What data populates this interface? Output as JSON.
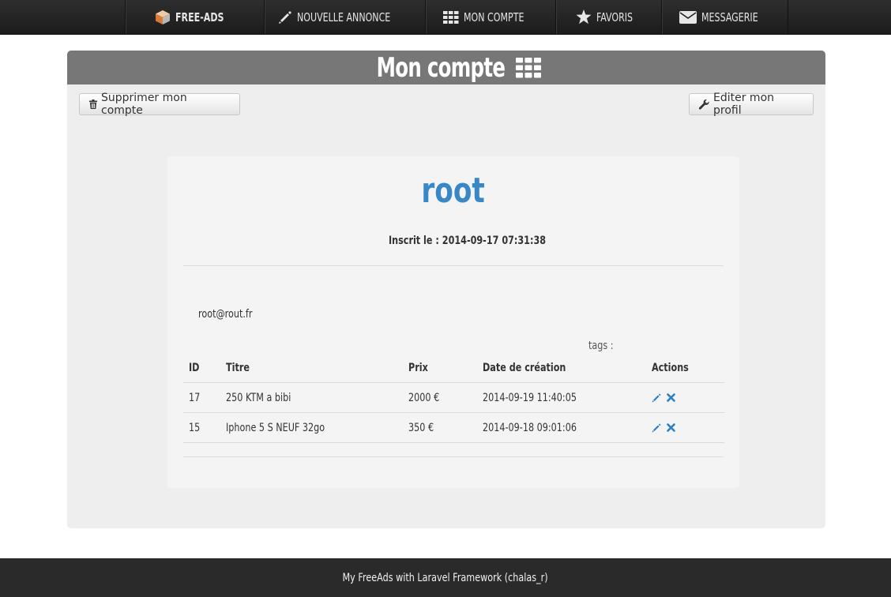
{
  "nav": {
    "items": [
      {
        "label": "FREE-ADS",
        "icon": "cube-logo-icon"
      },
      {
        "label": "NOUVELLE ANNONCE",
        "icon": "pencil-icon"
      },
      {
        "label": "MON COMPTE",
        "icon": "grid-icon"
      },
      {
        "label": "FAVORIS",
        "icon": "star-icon"
      },
      {
        "label": "MESSAGERIE",
        "icon": "envelope-icon"
      }
    ]
  },
  "page": {
    "title": "Mon compte",
    "delete_button": "Supprimer mon compte",
    "edit_button": "Editer mon profil"
  },
  "profile": {
    "username": "root",
    "registered_label": "Inscrit le :",
    "registered_date": "2014-09-17 07:31:38",
    "email": "root@rout.fr",
    "tags_label": "tags :"
  },
  "table": {
    "headers": {
      "id": "ID",
      "title": "Titre",
      "price": "Prix",
      "date": "Date de création",
      "actions": "Actions"
    },
    "rows": [
      {
        "id": "17",
        "title": "250 KTM a bibi",
        "price": "2000 €",
        "date": "2014-09-19 11:40:05"
      },
      {
        "id": "15",
        "title": "Iphone 5 S NEUF 32go",
        "price": "350 €",
        "date": "2014-09-18 09:01:06"
      }
    ]
  },
  "footer": {
    "text": "My FreeAds with Laravel Framework (chalas_r)"
  },
  "colors": {
    "accent": "#3a87c8",
    "header_bar": "#777777",
    "nav_bg": "#222222",
    "footer_bg": "#2a2a2a"
  }
}
